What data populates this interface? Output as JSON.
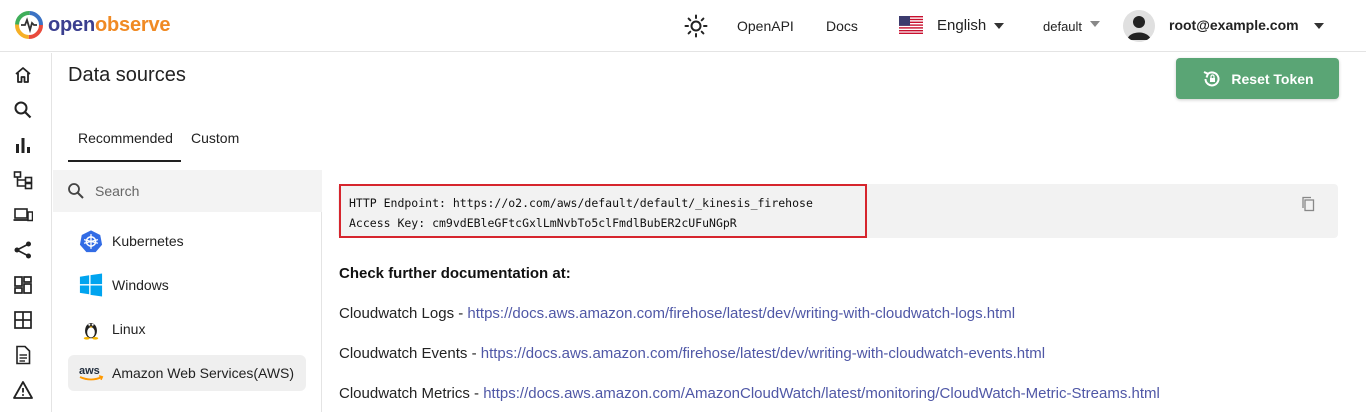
{
  "header": {
    "logo_part1": "open",
    "logo_part2": "observe",
    "theme_icon": "sun-icon",
    "openapi": "OpenAPI",
    "docs": "Docs",
    "language": "English",
    "org": "default",
    "user": "root@example.com"
  },
  "rail": {
    "icons": [
      "home-icon",
      "search-icon",
      "bar-chart-icon",
      "hierarchy-icon",
      "devices-icon",
      "share-icon",
      "dashboard-icon",
      "grid-icon",
      "document-icon",
      "warning-icon"
    ]
  },
  "main": {
    "title": "Data sources",
    "reset_button": "Reset Token",
    "tabs": [
      "Recommended",
      "Custom"
    ]
  },
  "sources": {
    "search_placeholder": "Search",
    "items": [
      "Kubernetes",
      "Windows",
      "Linux",
      "Amazon Web Services(AWS)"
    ]
  },
  "code": {
    "line1": "HTTP Endpoint: https://o2.com/aws/default/default/_kinesis_firehose",
    "line2": "Access Key: cm9vdEBleGFtcGxlLmNvbTo5clFmdlBubER2cUFuNGpR"
  },
  "docs": {
    "heading": "Check further documentation at:",
    "links": [
      {
        "label": "Cloudwatch Logs - ",
        "url": "https://docs.aws.amazon.com/firehose/latest/dev/writing-with-cloudwatch-logs.html"
      },
      {
        "label": "Cloudwatch Events - ",
        "url": "https://docs.aws.amazon.com/firehose/latest/dev/writing-with-cloudwatch-events.html"
      },
      {
        "label": "Cloudwatch Metrics - ",
        "url": "https://docs.aws.amazon.com/AmazonCloudWatch/latest/monitoring/CloudWatch-Metric-Streams.html"
      }
    ]
  },
  "colors": {
    "accent_green": "#5aa575",
    "highlight_red": "#d6252d",
    "link": "#4f57a6"
  }
}
